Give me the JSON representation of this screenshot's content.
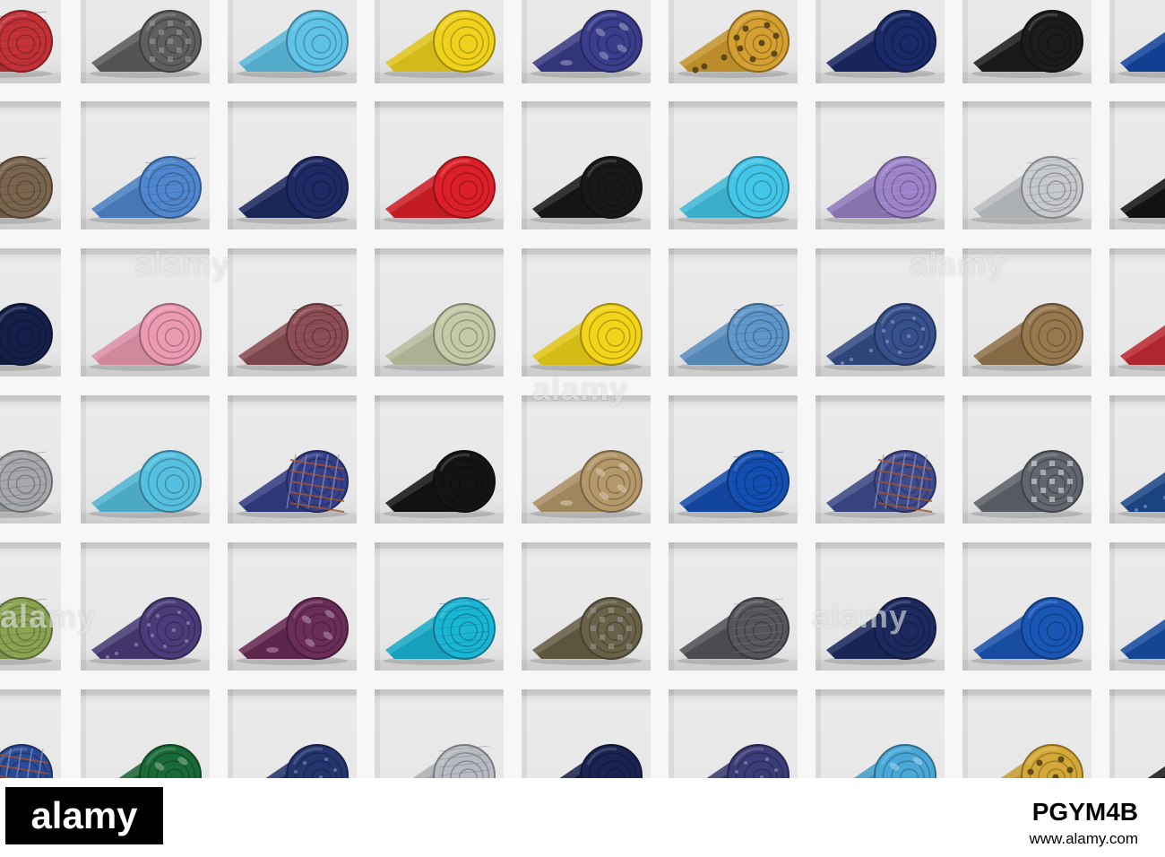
{
  "photo": {
    "subject": "Neckties displayed in a white grid of cubby shelves",
    "rows": [
      [
        {
          "color": "#c43238",
          "pattern": "textured"
        },
        {
          "color": "#5f5f5f",
          "pattern": "houndstooth"
        },
        {
          "color": "#5fc3e8",
          "pattern": "plain"
        },
        {
          "color": "#f0d21c",
          "pattern": "plain"
        },
        {
          "color": "#3a3c8c",
          "pattern": "paisley"
        },
        {
          "color": "#d4a030",
          "pattern": "medallion"
        },
        {
          "color": "#1a2a68",
          "pattern": "plain"
        },
        {
          "color": "#1c1c1e",
          "pattern": "plain"
        },
        {
          "color": "#1448a6",
          "pattern": "plain"
        }
      ],
      [
        {
          "color": "#7a664e",
          "pattern": "textured"
        },
        {
          "color": "#4f88d0",
          "pattern": "textured"
        },
        {
          "color": "#1e2a64",
          "pattern": "plain"
        },
        {
          "color": "#dc1f28",
          "pattern": "plain"
        },
        {
          "color": "#18181a",
          "pattern": "plain"
        },
        {
          "color": "#43c6e8",
          "pattern": "plain"
        },
        {
          "color": "#9c82c8",
          "pattern": "striped"
        },
        {
          "color": "#c6c9cd",
          "pattern": "textured"
        },
        {
          "color": "#141414",
          "pattern": "plain"
        }
      ],
      [
        {
          "color": "#15204a",
          "pattern": "plain"
        },
        {
          "color": "#ec9ab2",
          "pattern": "plain"
        },
        {
          "color": "#8e4e56",
          "pattern": "textured"
        },
        {
          "color": "#c4c9a8",
          "pattern": "plain"
        },
        {
          "color": "#f2d418",
          "pattern": "plain"
        },
        {
          "color": "#5f98cc",
          "pattern": "textured"
        },
        {
          "color": "#35508a",
          "pattern": "dotted"
        },
        {
          "color": "#98784e",
          "pattern": "plain"
        },
        {
          "color": "#c82b35",
          "pattern": "striped"
        }
      ],
      [
        {
          "color": "#a6a8ac",
          "pattern": "textured"
        },
        {
          "color": "#56c0e0",
          "pattern": "plain"
        },
        {
          "color": "#34408a",
          "pattern": "plaid"
        },
        {
          "color": "#141414",
          "pattern": "plain"
        },
        {
          "color": "#b4986a",
          "pattern": "paisley"
        },
        {
          "color": "#1450b4",
          "pattern": "textured"
        },
        {
          "color": "#3e4c8e",
          "pattern": "plaid"
        },
        {
          "color": "#62666e",
          "pattern": "greek-key"
        },
        {
          "color": "#1e4c90",
          "pattern": "dotted"
        }
      ],
      [
        {
          "color": "#8aa452",
          "pattern": "textured"
        },
        {
          "color": "#4a3c7a",
          "pattern": "dotted"
        },
        {
          "color": "#6a2c58",
          "pattern": "paisley"
        },
        {
          "color": "#1ab6d6",
          "pattern": "textured"
        },
        {
          "color": "#6a6248",
          "pattern": "houndstooth"
        },
        {
          "color": "#54565c",
          "pattern": "striped"
        },
        {
          "color": "#1c2a60",
          "pattern": "plain"
        },
        {
          "color": "#1a56b6",
          "pattern": "plain"
        },
        {
          "color": "#1850a8",
          "pattern": "plain"
        }
      ],
      [
        {
          "color": "#2a4a96",
          "pattern": "plaid"
        },
        {
          "color": "#1a6a38",
          "pattern": "paisley"
        },
        {
          "color": "#24366e",
          "pattern": "dotted"
        },
        {
          "color": "#b8bcc2",
          "pattern": "textured"
        },
        {
          "color": "#1a2450",
          "pattern": "plain"
        },
        {
          "color": "#3c3c78",
          "pattern": "dotted"
        },
        {
          "color": "#4aa8d8",
          "pattern": "paisley"
        },
        {
          "color": "#d4a838",
          "pattern": "medallion"
        },
        {
          "color": "#1a1a1a",
          "pattern": "plain"
        }
      ]
    ]
  },
  "watermark": {
    "text": "alamy",
    "color": "#ffffff"
  },
  "footer": {
    "brand": "alamy",
    "image_id": "PGYM4B",
    "website": "www.alamy.com",
    "brand_bg": "#000000",
    "text_color": "#000000"
  }
}
